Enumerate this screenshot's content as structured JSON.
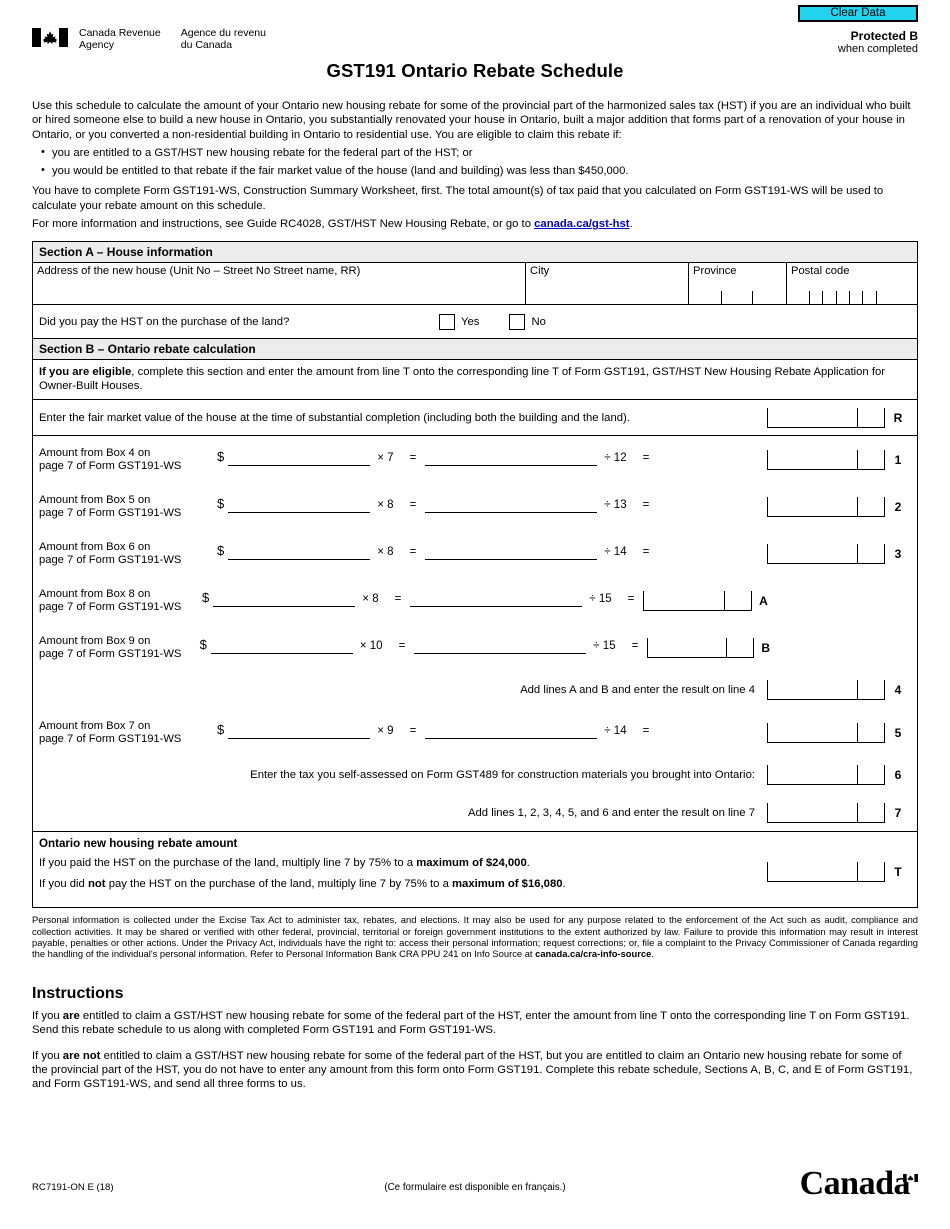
{
  "header": {
    "clear_button": "Clear Data",
    "protected_label": "Protected B",
    "protected_sub": "when completed",
    "agency_en_line1": "Canada Revenue",
    "agency_en_line2": "Agency",
    "agency_fr_line1": "Agence du revenu",
    "agency_fr_line2": "du Canada",
    "flag_icon": "canada-flag-icon"
  },
  "title": "GST191 Ontario Rebate Schedule",
  "intro": {
    "paragraph1": "Use this schedule to calculate the amount of your Ontario new housing rebate for some of the provincial part of the harmonized sales tax (HST) if you are an individual who built or hired someone else to build a new house in Ontario, you substantially renovated your house in Ontario, built a major addition that forms part of a renovation of your house in Ontario, or you converted a non-residential building in Ontario to residential use. You are eligible to claim this rebate if:",
    "bullets": [
      "you are entitled to a GST/HST new housing rebate for the federal part of the HST; or",
      "you would be entitled to that rebate if the fair market value of the house (land and building) was less than $450,000."
    ],
    "paragraph2": "You have to complete Form GST191-WS, Construction Summary Worksheet, first. The total amount(s) of tax paid that you calculated on Form GST191-WS will be used to calculate your rebate amount on this schedule.",
    "paragraph3_pre": "For more information and instructions, see Guide RC4028, GST/HST New Housing Rebate, or go to ",
    "link_text": "canada.ca/gst-hst",
    "paragraph3_post": "."
  },
  "section_a": {
    "heading": "Section A – House information",
    "address_label": "Address of the new house (Unit No – Street No Street name, RR)",
    "city_label": "City",
    "province_label": "Province",
    "postal_label": "Postal code",
    "address_value": "",
    "city_value": "",
    "province_value": "",
    "postal_value": "",
    "hst_question": "Did you pay the HST on the purchase of the land?",
    "yes_label": "Yes",
    "no_label": "No"
  },
  "section_b": {
    "heading": "Section B – Ontario rebate calculation",
    "eligible_bold": "If you are eligible",
    "eligible_rest": ", complete this section and enter the amount from line T onto the corresponding line T of Form GST191, GST/HST New Housing Rebate Application for Owner-Built Houses.",
    "fmv_text": "Enter the fair market value of the house at the time of substantial completion (including both the building and the land).",
    "fmv_tag": "R",
    "fmv_value": "",
    "calc_rows": [
      {
        "label_line1": "Amount from Box 4 on",
        "label_line2": "page 7 of Form GST191-WS",
        "dollar": "$",
        "amount": "",
        "mult_op": "×",
        "mult": "7",
        "eq1": "=",
        "product": "",
        "div_op": "÷",
        "div": "12",
        "eq2": "=",
        "result": "",
        "tag": "1",
        "tag_style": "right"
      },
      {
        "label_line1": "Amount from Box 5 on",
        "label_line2": "page 7 of Form GST191-WS",
        "dollar": "$",
        "amount": "",
        "mult_op": "×",
        "mult": "8",
        "eq1": "=",
        "product": "",
        "div_op": "÷",
        "div": "13",
        "eq2": "=",
        "result": "",
        "tag": "2",
        "tag_style": "right"
      },
      {
        "label_line1": "Amount from Box 6 on",
        "label_line2": "page 7 of Form GST191-WS",
        "dollar": "$",
        "amount": "",
        "mult_op": "×",
        "mult": "8",
        "eq1": "=",
        "product": "",
        "div_op": "÷",
        "div": "14",
        "eq2": "=",
        "result": "",
        "tag": "3",
        "tag_style": "right"
      },
      {
        "label_line1": "Amount from Box 8 on",
        "label_line2": "page 7 of Form GST191-WS",
        "dollar": "$",
        "amount": "",
        "mult_op": "×",
        "mult": "8",
        "eq1": "=",
        "product": "",
        "div_op": "÷",
        "div": "15",
        "eq2": "=",
        "result": "",
        "tag": "A",
        "tag_style": "mid"
      },
      {
        "label_line1": "Amount from Box 9 on",
        "label_line2": "page 7 of Form GST191-WS",
        "dollar": "$",
        "amount": "",
        "mult_op": "×",
        "mult": "10",
        "eq1": "=",
        "product": "",
        "div_op": "÷",
        "div": "15",
        "eq2": "=",
        "result": "",
        "tag": "B",
        "tag_style": "mid"
      }
    ],
    "add_ab_text": "Add lines A and B and enter the result on line 4",
    "add_ab_tag": "4",
    "add_ab_value": "",
    "row_box7": {
      "label_line1": "Amount from Box 7 on",
      "label_line2": "page 7 of Form GST191-WS",
      "dollar": "$",
      "amount": "",
      "mult_op": "×",
      "mult": "9",
      "eq1": "=",
      "product": "",
      "div_op": "÷",
      "div": "14",
      "eq2": "=",
      "result": "",
      "tag": "5",
      "tag_style": "right"
    },
    "self_assessed_text": "Enter the tax you self-assessed on Form GST489 for construction materials you brought into Ontario:",
    "self_assessed_tag": "6",
    "self_assessed_value": "",
    "add_all_text": "Add lines 1, 2, 3, 4, 5, and 6 and enter the result on line 7",
    "add_all_tag": "7",
    "add_all_value": ""
  },
  "rebate": {
    "heading": "Ontario new housing rebate amount",
    "line_paid_pre": "If you paid the HST on the purchase of the land, multiply line 7 by 75% to a ",
    "line_paid_bold": "maximum of $24,000",
    "line_paid_post": ".",
    "line_notpaid_pre": "If you did ",
    "line_notpaid_bold1": "not",
    "line_notpaid_mid": " pay the HST on the purchase of the land, multiply line 7 by 75% to a ",
    "line_notpaid_bold2": "maximum of $16,080",
    "line_notpaid_post": ".",
    "tag": "T",
    "value": ""
  },
  "privacy": {
    "text_pre": "Personal information is collected under the Excise Tax Act to administer tax, rebates, and elections. It may also be used for any purpose related to the enforcement of the Act such as audit, compliance and collection activities. It may be shared or verified with other federal, provincial, territorial or foreign government institutions to the extent authorized by law. Failure to provide this information may result in interest payable, penalties or other actions. Under the Privacy Act, individuals have the right to: access their personal information; request corrections; or, file a complaint to the Privacy Commissioner of Canada regarding the handling of the individual's personal information. Refer to Personal Information Bank CRA PPU 241 on Info Source at ",
    "text_bold": "canada.ca/cra-info-source",
    "text_post": "."
  },
  "instructions": {
    "heading": "Instructions",
    "p1_pre": "If you ",
    "p1_bold": "are",
    "p1_post": " entitled to claim a GST/HST new housing rebate for some of the federal part of the HST, enter the amount from line T onto the corresponding line T on Form GST191. Send this rebate schedule to us along with completed Form GST191 and Form GST191-WS.",
    "p2_pre": "If you ",
    "p2_bold": "are not",
    "p2_post": " entitled to claim a GST/HST new housing rebate for some of the federal part of the HST, but you are entitled to claim an Ontario new housing rebate for some of the provincial part of the HST, you do not have to enter any amount from this form onto Form GST191. Complete this rebate schedule, Sections A, B, C, and E of Form GST191, and Form GST191-WS, and send all three forms to us."
  },
  "footer": {
    "form_code": "RC7191-ON E (18)",
    "french_note": "(Ce formulaire est disponible en français.)",
    "wordmark": "Canada",
    "wordmark_flag_icon": "canada-flag-icon"
  },
  "colors": {
    "clear_button_bg": "#22d3ee",
    "section_header_bg": "#ececec",
    "link": "#0000cc",
    "border": "#000000"
  }
}
